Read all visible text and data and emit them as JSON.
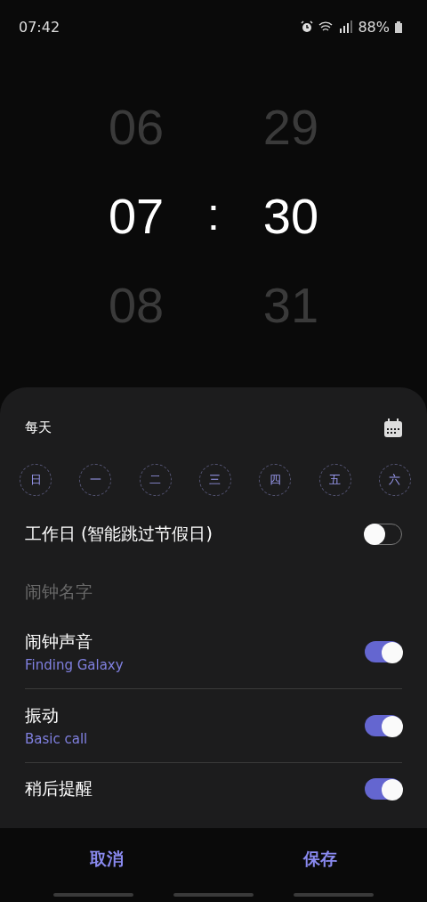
{
  "status_bar": {
    "time": "07:42",
    "battery": "88%"
  },
  "picker": {
    "hours": [
      "06",
      "07",
      "08"
    ],
    "minutes": [
      "29",
      "30",
      "31"
    ],
    "separator": ":"
  },
  "sheet": {
    "repeat_label": "每天",
    "days": [
      {
        "label": "日",
        "selected": false
      },
      {
        "label": "一",
        "selected": false
      },
      {
        "label": "二",
        "selected": false
      },
      {
        "label": "三",
        "selected": false
      },
      {
        "label": "四",
        "selected": false
      },
      {
        "label": "五",
        "selected": false
      },
      {
        "label": "六",
        "selected": false
      }
    ],
    "workday": {
      "label": "工作日 (智能跳过节假日)",
      "on": false
    },
    "name_field": {
      "placeholder": "闹钟名字"
    },
    "settings": [
      {
        "title": "闹钟声音",
        "value": "Finding Galaxy",
        "on": true
      },
      {
        "title": "振动",
        "value": "Basic call",
        "on": true
      },
      {
        "title": "稍后提醒",
        "on": true
      }
    ]
  },
  "buttons": [
    "取消",
    "保存"
  ]
}
